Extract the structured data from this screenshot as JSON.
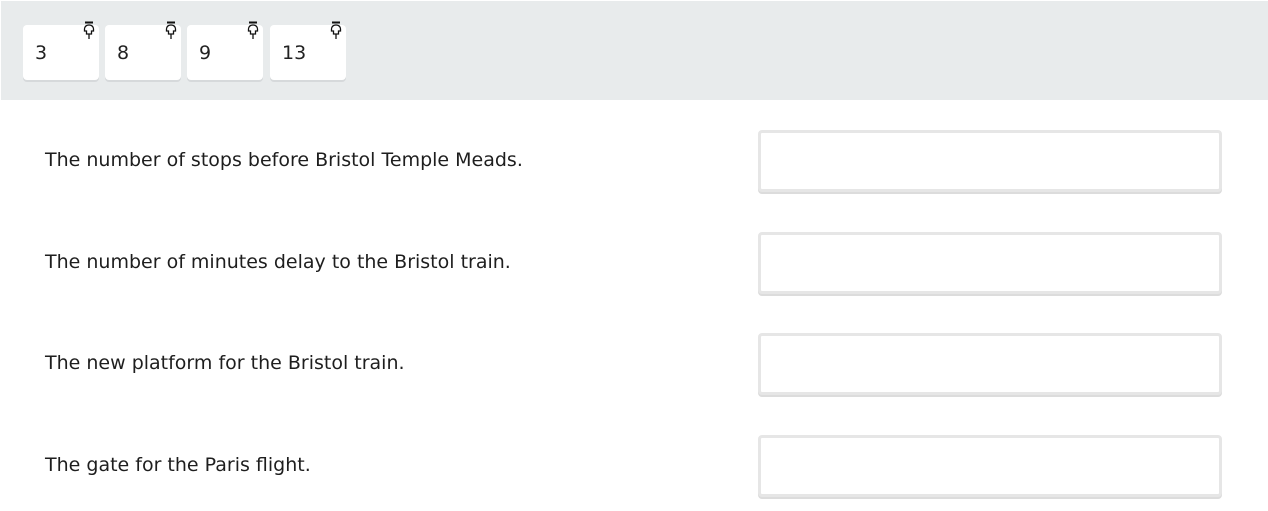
{
  "tiles": [
    {
      "value": "3",
      "icon": "pin-icon"
    },
    {
      "value": "8",
      "icon": "pin-icon"
    },
    {
      "value": "9",
      "icon": "pin-icon"
    },
    {
      "value": "13",
      "icon": "pin-icon"
    }
  ],
  "questions": [
    {
      "prompt": "The number of stops before Bristol Temple Meads.",
      "answer": ""
    },
    {
      "prompt": "The number of minutes delay to the Bristol train.",
      "answer": ""
    },
    {
      "prompt": "The new platform for the Bristol train.",
      "answer": ""
    },
    {
      "prompt": "The gate for the Paris flight.",
      "answer": ""
    }
  ]
}
